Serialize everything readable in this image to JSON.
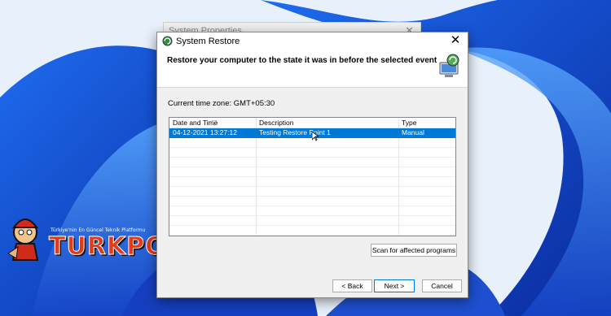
{
  "background_window": {
    "title": "System Properties",
    "close": "✕"
  },
  "dialog": {
    "title": "System Restore",
    "close": "✕",
    "header": "Restore your computer to the state it was in before the selected event",
    "timezone": "Current time zone: GMT+05:30",
    "columns": [
      "Date and Time",
      "Description",
      "Type"
    ],
    "rows": [
      {
        "date": "04-12-2021 13:27:12",
        "description": "Testing Restore Point 1",
        "type": "Manual"
      }
    ],
    "scan_button": "Scan for affected programs",
    "back_button": "< Back",
    "next_button": "Next >",
    "cancel_button": "Cancel"
  },
  "logo": {
    "name": "TURKPOMS",
    "tagline": "Türkiye'nin En Güncel Teknik Platformu"
  },
  "colors": {
    "selection": "#0078d7",
    "wallpaper": "#0a2fa8"
  }
}
